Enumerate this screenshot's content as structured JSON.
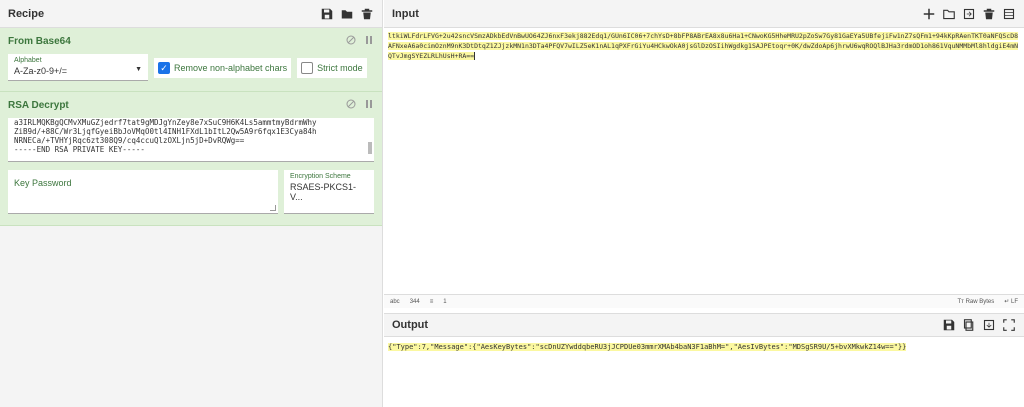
{
  "recipe": {
    "title": "Recipe",
    "ops": [
      {
        "name": "From Base64",
        "alphabet_label": "Alphabet",
        "alphabet_value": "A-Za-z0-9+/=",
        "remove_non_alpha_label": "Remove non-alphabet chars",
        "remove_non_alpha_checked": true,
        "strict_mode_label": "Strict mode",
        "strict_mode_checked": false
      },
      {
        "name": "RSA Decrypt",
        "key_lines": [
          "a3IRLMQKBgQCMvXMuGZjedrf7tat9gMDJgYnZey8e7xSuC9H6K4Ls5ammtmyBdrmWhy",
          "ZiB9d/+88C/Wr3LjqfGyeiBbJoVMqO0tl4INH1FXdL1bItL2Qw5A9r6fqx1E3Cya84h",
          "NRNECa/+TVHYjRqc6zt308Q9/cq4ccuQlzOXLjn5jD+DvRQWg==",
          "-----END RSA PRIVATE KEY-----"
        ],
        "key_password_placeholder": "Key Password",
        "encryption_scheme_label": "Encryption Scheme",
        "encryption_scheme_value": "RSAES-PKCS1-V..."
      }
    ]
  },
  "input": {
    "title": "Input",
    "text": "ltkiWLFdrLFVG+2u42sncVSmzADkbEdVnBwUO64ZJ6nxF3ekj882Edq1/GUn6IC06+7chYsD+8bFP8ABrEA8x8u6Ha1+CNwoKG5HheMRU2pZoSw7Gy81GaEYa5UBfejiFw1nZ7sQFm1+94kKpRAenTKT0aNFQScD8AFNxeA6a0cimOznM9nK3DtDtqZ1ZJjzkMN1n3DTa4PFQV7wILZ5eK1nAL1qPXFrGiYu4HCkwOkA0jsGlDzOSIihWgdkg1SAJPEtoqr+0K/dwZdoAp6jhrwU6wqROQlBJHa3rdmOD1oh861VquNMMbMl8hldgiE4mNQTvJmgSYEZLRLhUsH+RA==",
    "status": {
      "length": "344",
      "lines": "1",
      "raw_bytes": "Raw Bytes",
      "lf": "LF"
    }
  },
  "output": {
    "title": "Output",
    "text": "{\"Type\":7,\"Message\":{\"AesKeyBytes\":\"scDnUZYwddqbeRU3jJCPDUe03mmrXMAb4baN3F1aBhM=\",\"AesIvBytes\":\"MDSgSR9U/5+bvXMkwkZ14w==\"}}"
  },
  "colors": {
    "op_bg": "#dff0d8",
    "op_text": "#3c763d",
    "highlight": "#fbf8a0",
    "checkbox": "#1a73e8"
  }
}
